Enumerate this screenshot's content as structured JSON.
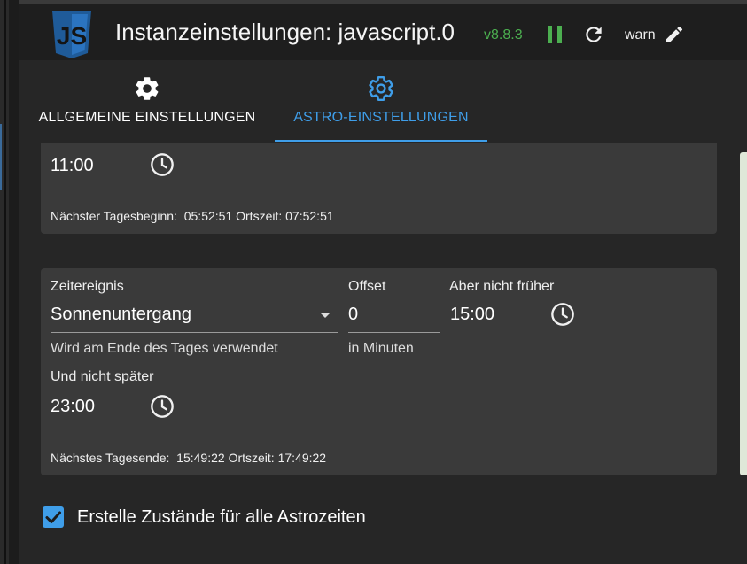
{
  "header": {
    "title": "Instanzeinstellungen: javascript.0",
    "version": "v8.8.3",
    "log_level": "warn",
    "logo_text": "JS",
    "colors": {
      "version": "#4caf50",
      "pause": "#4caf50",
      "logo": "#1f5b99"
    }
  },
  "tabs": [
    {
      "label": "ALLGEMEINE EINSTELLUNGEN",
      "icon": "gear-icon",
      "active": false
    },
    {
      "label": "ASTRO-EINSTELLUNGEN",
      "icon": "gear-icon",
      "active": true
    }
  ],
  "day_start": {
    "not_later_value": "11:00",
    "next_label": "Nächster Tagesbeginn:",
    "next_value": "05:52:51",
    "local_label": "Ortszeit:",
    "local_value": "07:52:51"
  },
  "day_end": {
    "event_label": "Zeitereignis",
    "event_value": "Sonnenuntergang",
    "event_helper": "Wird am Ende des Tages verwendet",
    "offset_label": "Offset",
    "offset_value": "0",
    "offset_helper": "in Minuten",
    "not_earlier_label": "Aber nicht früher",
    "not_earlier_value": "15:00",
    "not_later_label": "Und nicht später",
    "not_later_value": "23:00",
    "next_label": "Nächstes Tagesende:",
    "next_value": "15:49:22",
    "local_label": "Ortszeit:",
    "local_value": "17:49:22"
  },
  "create_states": {
    "label": "Erstelle Zustände für alle Astrozeiten",
    "checked": true
  },
  "accent_color": "#3f9ee9"
}
